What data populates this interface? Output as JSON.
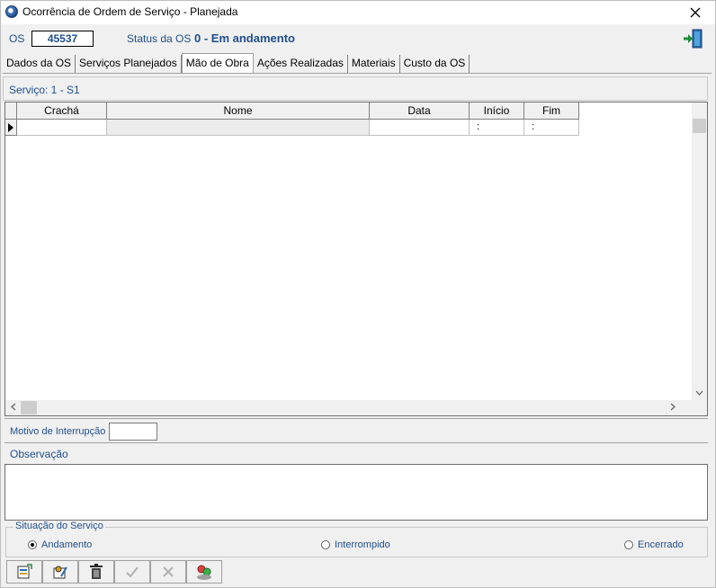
{
  "window": {
    "title": "Ocorrência de Ordem de Serviço - Planejada"
  },
  "header": {
    "os_label": "OS",
    "os_value": "45537",
    "status_label": "Status da OS",
    "status_value": "0 - Em andamento"
  },
  "tabs": [
    {
      "label": "Dados da OS",
      "active": false
    },
    {
      "label": "Serviços Planejados",
      "active": false
    },
    {
      "label": "Mão de Obra",
      "active": true
    },
    {
      "label": "Ações Realizadas",
      "active": false
    },
    {
      "label": "Materiais",
      "active": false
    },
    {
      "label": "Custo da OS",
      "active": false
    }
  ],
  "service": {
    "label": "Serviço: 1 - S1"
  },
  "grid": {
    "columns": [
      "Crachá",
      "Nome",
      "Data",
      "Início",
      "Fim"
    ],
    "rows": [
      [
        "",
        "",
        "",
        ":",
        ":"
      ]
    ]
  },
  "motivo": {
    "label": "Motivo de Interrupção",
    "value": ""
  },
  "observacao": {
    "label": "Observação",
    "value": ""
  },
  "situacao": {
    "legend": "Situação do Serviço",
    "options": [
      {
        "label": "Andamento",
        "selected": true
      },
      {
        "label": "Interrompido",
        "selected": false
      },
      {
        "label": "Encerrado",
        "selected": false
      }
    ]
  },
  "toolbar": [
    {
      "icon": "new-record-icon",
      "enabled": true
    },
    {
      "icon": "edit-record-icon",
      "enabled": true
    },
    {
      "icon": "trash-icon",
      "enabled": true
    },
    {
      "icon": "check-icon",
      "enabled": false
    },
    {
      "icon": "cancel-icon",
      "enabled": false
    },
    {
      "icon": "people-icon",
      "enabled": true
    }
  ],
  "colors": {
    "label_blue": "#1f4e8c",
    "window_bg": "#f0f0f0"
  }
}
